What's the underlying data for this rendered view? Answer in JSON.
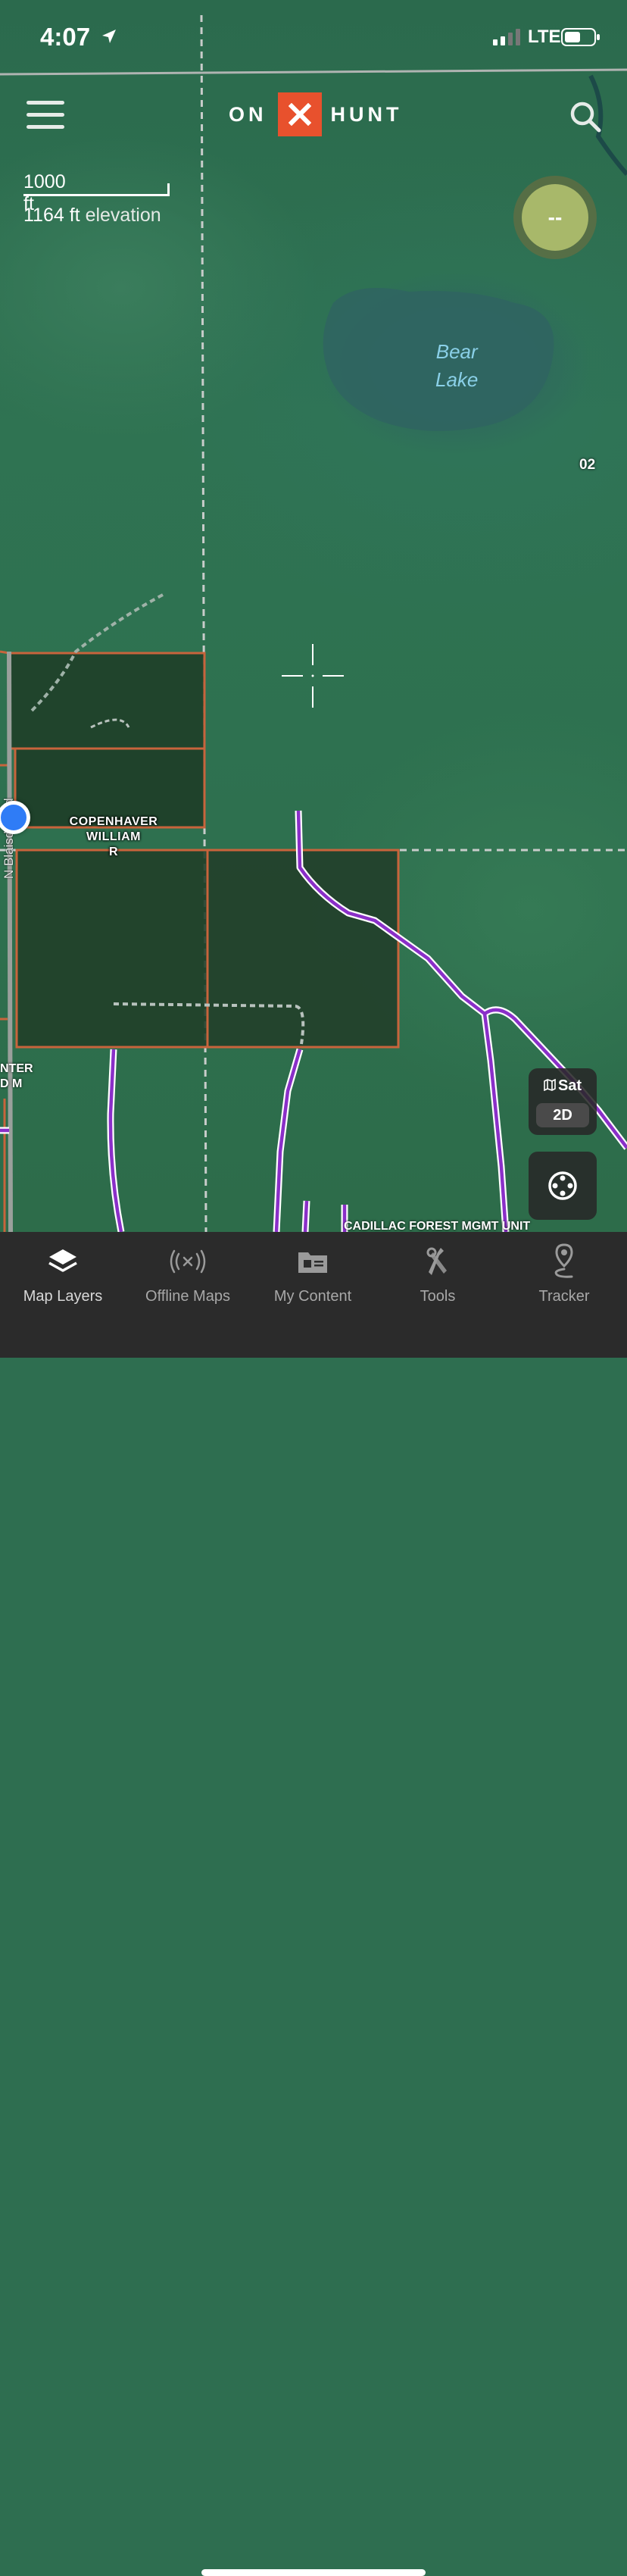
{
  "status_bar": {
    "time": "4:07",
    "network": "LTE"
  },
  "header": {
    "logo_left": "ON",
    "logo_right": "HUNT"
  },
  "map": {
    "scale_distance": "1000 ft",
    "elevation_value": "1164 ft",
    "elevation_label": "elevation",
    "compass_text": "--",
    "lake_label_line1": "Bear",
    "lake_label_line2": "Lake",
    "road_badge": "02",
    "owner_label_line1": "COPENHAVER",
    "owner_label_line2": "WILLIAM",
    "owner_label_line3": "R",
    "partial_label_line1": "NTER",
    "partial_label_line2": "D M",
    "road_name": "N Blaisdell Rd",
    "forest_unit_label": "CADILLAC FOREST MGMT UNIT",
    "colors": {
      "parcel_outline": "#c8643c",
      "trail": "#8a2fc8",
      "user_location": "#2f7cf6",
      "brand_accent": "#e8512d"
    }
  },
  "map_style": {
    "layer": "Sat",
    "mode": "2D"
  },
  "tabbar": {
    "items": [
      {
        "label": "Map Layers",
        "icon": "layers-icon"
      },
      {
        "label": "Offline Maps",
        "icon": "offline-signal-icon"
      },
      {
        "label": "My Content",
        "icon": "content-folder-icon"
      },
      {
        "label": "Tools",
        "icon": "tools-icon"
      },
      {
        "label": "Tracker",
        "icon": "tracker-pin-icon"
      }
    ]
  }
}
